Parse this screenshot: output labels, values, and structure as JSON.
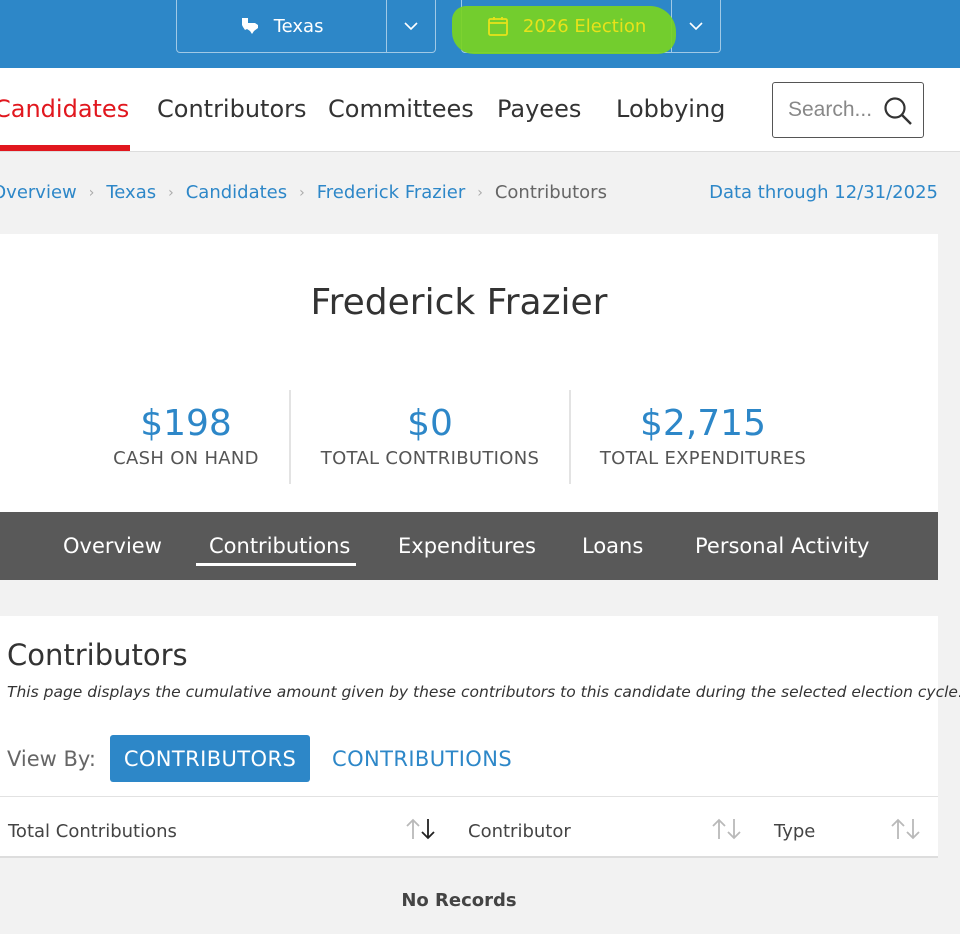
{
  "topbar": {
    "state_label": "Texas",
    "election_label": "2026 Election",
    "accent": "#2d87c8",
    "highlight": "#7ad321"
  },
  "nav": {
    "items": [
      "Candidates",
      "Contributors",
      "Committees",
      "Payees",
      "Lobbying"
    ],
    "active": "Candidates",
    "search_placeholder": "Search..."
  },
  "breadcrumb": {
    "items": [
      "Overview",
      "Texas",
      "Candidates",
      "Frederick Frazier",
      "Contributors"
    ],
    "data_through": "Data through 12/31/2025"
  },
  "candidate": {
    "name": "Frederick Frazier",
    "stats": [
      {
        "value": "$198",
        "label": "CASH ON HAND"
      },
      {
        "value": "$0",
        "label": "TOTAL CONTRIBUTIONS"
      },
      {
        "value": "$2,715",
        "label": "TOTAL EXPENDITURES"
      }
    ]
  },
  "tabs": {
    "items": [
      "Overview",
      "Contributions",
      "Expenditures",
      "Loans",
      "Personal Activity"
    ],
    "active": "Contributions"
  },
  "contributors": {
    "title": "Contributors",
    "description": "This page displays the cumulative amount given by these contributors to this candidate during the selected election cycle.",
    "view_by_label": "View By:",
    "view_contributors": "CONTRIBUTORS",
    "view_contributions": "CONTRIBUTIONS",
    "columns": [
      "Total Contributions",
      "Contributor",
      "Type"
    ],
    "empty": "No Records"
  },
  "icons": {
    "state": "texas-shape-icon",
    "calendar": "calendar-icon",
    "search": "search-icon",
    "caret": "chevron-down-icon",
    "sort": "sort-arrows-icon"
  }
}
